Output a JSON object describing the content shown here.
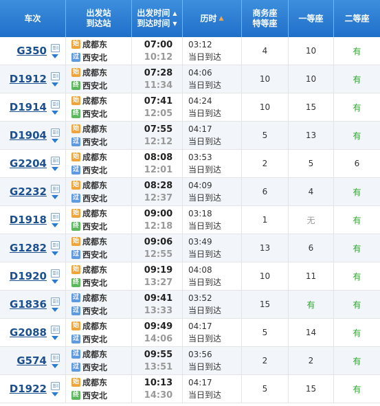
{
  "colors": {
    "header_bg": "#2a7bd2",
    "train_link": "#1b4f8d",
    "available": "#2aa52a",
    "none": "#999999",
    "start_badge": "#f0a43b",
    "pass_badge": "#5f9ae0",
    "end_badge": "#5cb85c"
  },
  "header": {
    "train": "车次",
    "stations_1": "出发站",
    "stations_2": "到达站",
    "times_1": "出发时间",
    "times_2": "到达时间",
    "duration": "历时",
    "business_1": "商务座",
    "business_2": "特等座",
    "first": "一等座",
    "second": "二等座"
  },
  "labels": {
    "same_day": "当日到达"
  },
  "rows": [
    {
      "train": "G350",
      "from": "成都东",
      "from_badge": "始",
      "to": "西安北",
      "to_badge": "过",
      "dep": "07:00",
      "arr": "10:12",
      "dur": "03:12",
      "same_day": "当日到达",
      "business": "4",
      "first": "10",
      "second": "有"
    },
    {
      "train": "D1912",
      "from": "成都东",
      "from_badge": "始",
      "to": "西安北",
      "to_badge": "终",
      "dep": "07:28",
      "arr": "11:34",
      "dur": "04:06",
      "same_day": "当日到达",
      "business": "10",
      "first": "10",
      "second": "有"
    },
    {
      "train": "D1914",
      "from": "成都东",
      "from_badge": "始",
      "to": "西安北",
      "to_badge": "终",
      "dep": "07:41",
      "arr": "12:05",
      "dur": "04:24",
      "same_day": "当日到达",
      "business": "10",
      "first": "15",
      "second": "有"
    },
    {
      "train": "D1904",
      "from": "成都东",
      "from_badge": "始",
      "to": "西安北",
      "to_badge": "过",
      "dep": "07:55",
      "arr": "12:12",
      "dur": "04:17",
      "same_day": "当日到达",
      "business": "5",
      "first": "13",
      "second": "有"
    },
    {
      "train": "G2204",
      "from": "成都东",
      "from_badge": "始",
      "to": "西安北",
      "to_badge": "过",
      "dep": "08:08",
      "arr": "12:01",
      "dur": "03:53",
      "same_day": "当日到达",
      "business": "2",
      "first": "5",
      "second": "6"
    },
    {
      "train": "G2232",
      "from": "成都东",
      "from_badge": "始",
      "to": "西安北",
      "to_badge": "过",
      "dep": "08:28",
      "arr": "12:37",
      "dur": "04:09",
      "same_day": "当日到达",
      "business": "6",
      "first": "4",
      "second": "有"
    },
    {
      "train": "D1918",
      "from": "成都东",
      "from_badge": "始",
      "to": "西安北",
      "to_badge": "终",
      "dep": "09:00",
      "arr": "12:18",
      "dur": "03:18",
      "same_day": "当日到达",
      "business": "1",
      "first": "无",
      "second": "有"
    },
    {
      "train": "G1282",
      "from": "成都东",
      "from_badge": "始",
      "to": "西安北",
      "to_badge": "过",
      "dep": "09:06",
      "arr": "12:55",
      "dur": "03:49",
      "same_day": "当日到达",
      "business": "13",
      "first": "6",
      "second": "有"
    },
    {
      "train": "D1920",
      "from": "成都东",
      "from_badge": "始",
      "to": "西安北",
      "to_badge": "终",
      "dep": "09:19",
      "arr": "13:27",
      "dur": "04:08",
      "same_day": "当日到达",
      "business": "10",
      "first": "11",
      "second": "有"
    },
    {
      "train": "G1836",
      "from": "成都东",
      "from_badge": "过",
      "to": "西安北",
      "to_badge": "过",
      "dep": "09:41",
      "arr": "13:33",
      "dur": "03:52",
      "same_day": "当日到达",
      "business": "15",
      "first": "有",
      "second": "有"
    },
    {
      "train": "G2088",
      "from": "成都东",
      "from_badge": "始",
      "to": "西安北",
      "to_badge": "过",
      "dep": "09:49",
      "arr": "14:06",
      "dur": "04:17",
      "same_day": "当日到达",
      "business": "5",
      "first": "14",
      "second": "有"
    },
    {
      "train": "G574",
      "from": "成都东",
      "from_badge": "过",
      "to": "西安北",
      "to_badge": "过",
      "dep": "09:55",
      "arr": "13:51",
      "dur": "03:56",
      "same_day": "当日到达",
      "business": "2",
      "first": "2",
      "second": "有"
    },
    {
      "train": "D1922",
      "from": "成都东",
      "from_badge": "始",
      "to": "西安北",
      "to_badge": "终",
      "dep": "10:13",
      "arr": "14:30",
      "dur": "04:17",
      "same_day": "当日到达",
      "business": "5",
      "first": "15",
      "second": "有"
    }
  ]
}
